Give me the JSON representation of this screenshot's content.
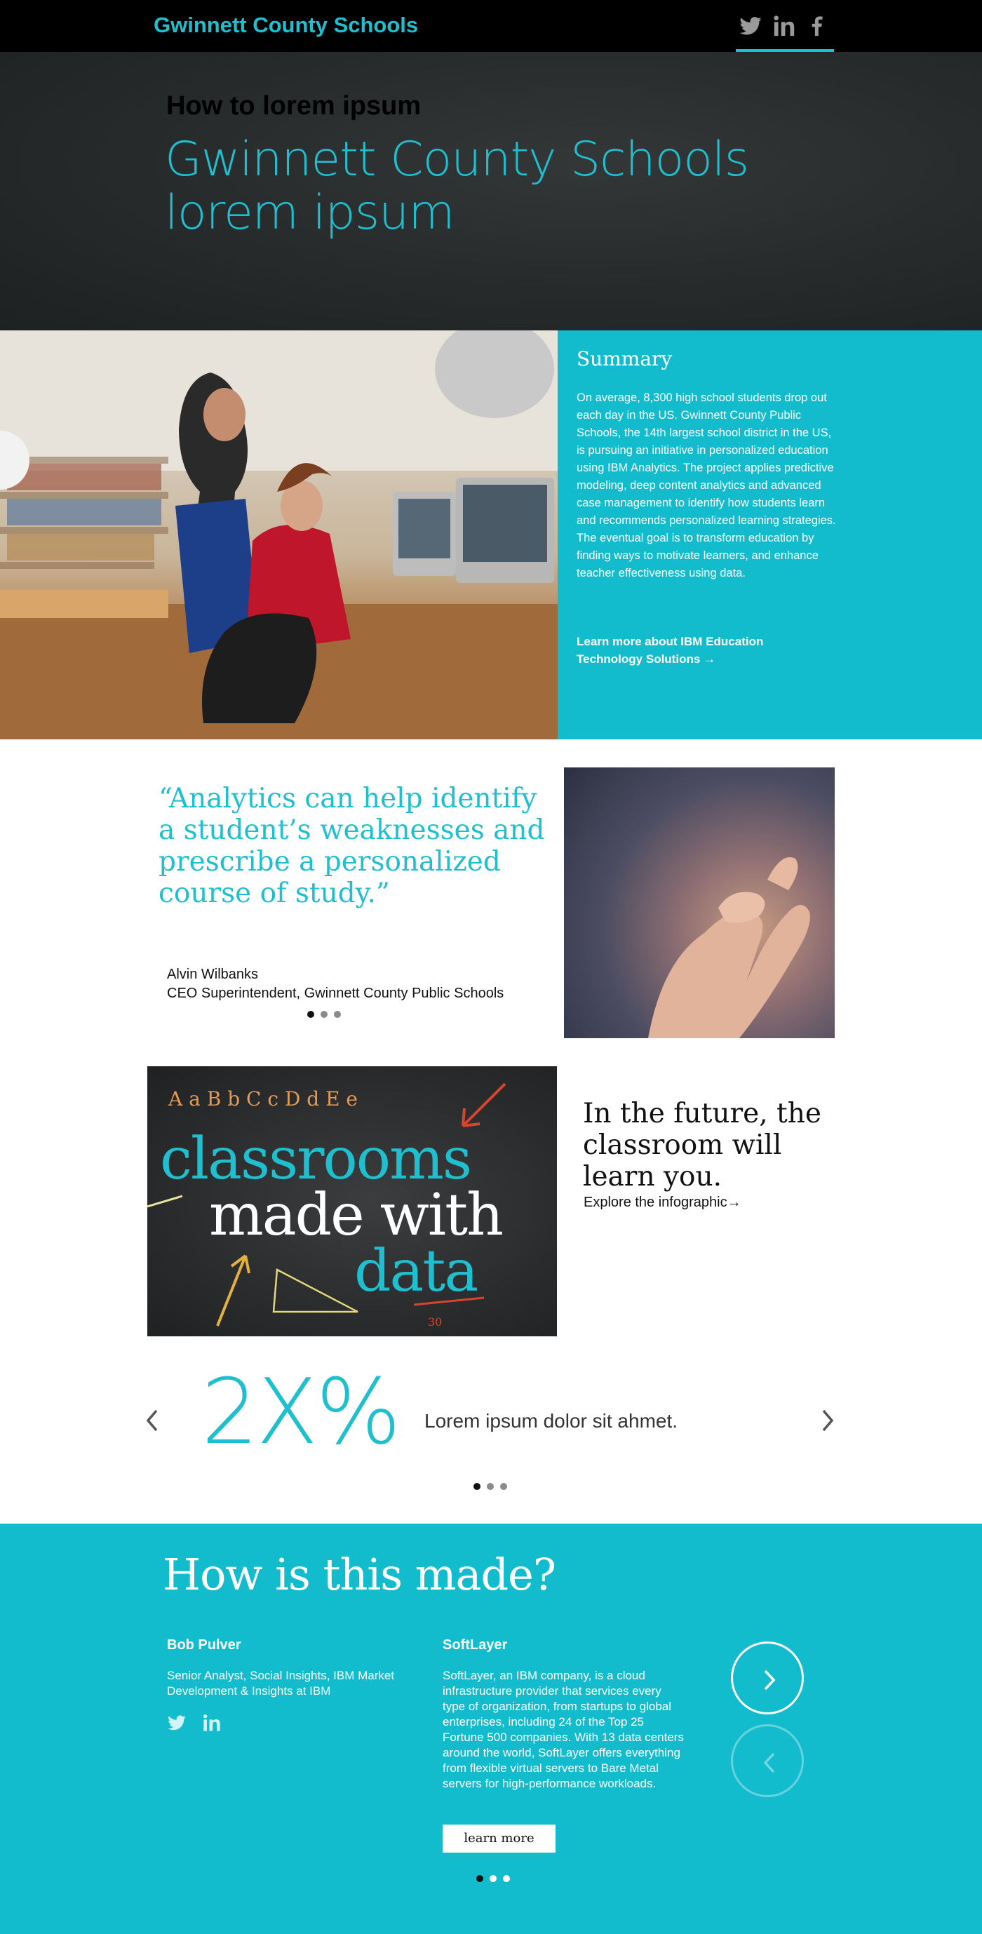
{
  "header": {
    "brand": "Gwinnett County Schools",
    "social_icons": [
      "twitter-icon",
      "linkedin-icon",
      "facebook-icon"
    ],
    "accent_color": "#1fbfcf"
  },
  "hero": {
    "kicker": "How to lorem ipsum",
    "title_line1": "Gwinnett County Schools",
    "title_line2": "lorem ipsum"
  },
  "summary": {
    "heading": "Summary",
    "body": "On average, 8,300 high school students drop out each day in the US. Gwinnett County Public Schools, the 14th largest school district in the US, is pursuing an initiative in personalized education using IBM Analytics. The project applies predictive modeling, deep content analytics and advanced case management to identify how students learn and recommends personalized learning strategies. The eventual goal is to transform education by finding ways to motivate learners, and enhance teacher effectiveness using data.",
    "link": "Learn more about IBM Education Technology Solutions →",
    "background_color": "#13bccd"
  },
  "quote": {
    "text": "“Analytics can help identify a student’s weaknesses and prescribe a personalized course of study.”",
    "author_name": "Alvin Wilbanks",
    "author_title": "CEO Superintendent, Gwinnett County Public Schools",
    "active_dot": 1,
    "dot_count": 3
  },
  "infographic": {
    "chalk_letters": "A a B b C c D d E e",
    "line1": "classrooms",
    "line2": "made with",
    "line3": "data",
    "chalk_number": "30",
    "title": "In the future, the classroom will learn you.",
    "link": "Explore the infographic→"
  },
  "stat": {
    "value": "2X%",
    "text": "Lorem ipsum dolor sit ahmet.",
    "active_dot": 1,
    "dot_count": 3
  },
  "how_made": {
    "title": "How is this made?",
    "person": {
      "name": "Bob Pulver",
      "role": "Senior Analyst, Social Insights, IBM Market Development & Insights at IBM",
      "social_icons": [
        "twitter-icon",
        "linkedin-icon"
      ]
    },
    "partner": {
      "name": "SoftLayer",
      "description": "SoftLayer, an IBM company, is a cloud infrastructure provider that services every type of organization, from startups to global enterprises, including 24 of the Top 25 Fortune 500 companies. With 13 data centers around the world, SoftLayer offers everything from flexible virtual servers to Bare Metal servers for high-performance workloads.",
      "button": "learn more"
    },
    "active_dot": 1,
    "dot_count": 3
  }
}
